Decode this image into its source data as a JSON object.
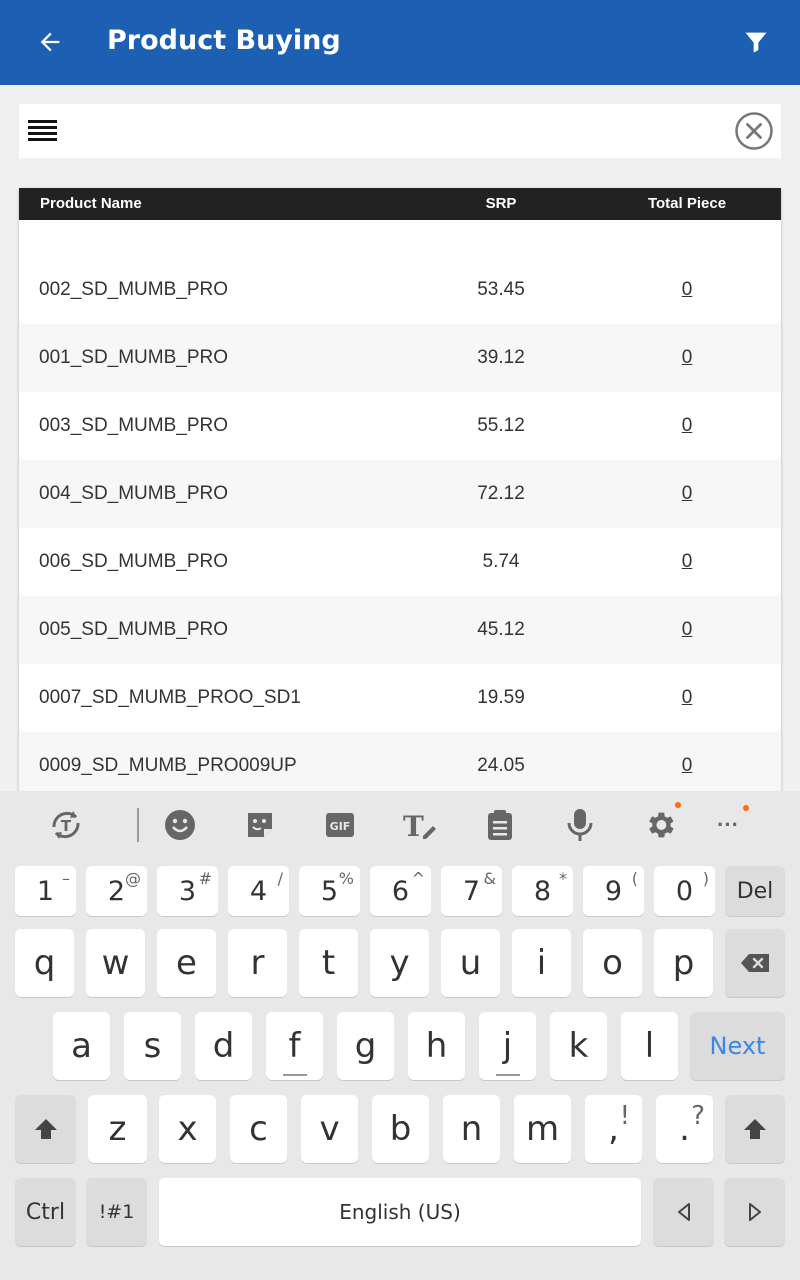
{
  "appbar": {
    "title": "Product Buying",
    "back_icon": "arrow-back-icon",
    "filter_icon": "filter-icon",
    "color": "#1c5fb3"
  },
  "search": {
    "menu_icon": "menu-lines-icon",
    "clear_icon": "close-circle-icon"
  },
  "table": {
    "headers": {
      "name": "Product Name",
      "srp": "SRP",
      "piece": "Total Piece"
    },
    "rows": [
      {
        "name": "002_SD_MUMB_PRO",
        "srp": "53.45",
        "piece": "0"
      },
      {
        "name": "001_SD_MUMB_PRO",
        "srp": "39.12",
        "piece": "0"
      },
      {
        "name": "003_SD_MUMB_PRO",
        "srp": "55.12",
        "piece": "0"
      },
      {
        "name": "004_SD_MUMB_PRO",
        "srp": "72.12",
        "piece": "0"
      },
      {
        "name": "006_SD_MUMB_PRO",
        "srp": "5.74",
        "piece": "0"
      },
      {
        "name": "005_SD_MUMB_PRO",
        "srp": "45.12",
        "piece": "0"
      },
      {
        "name": "0007_SD_MUMB_PROO_SD1",
        "srp": "19.59",
        "piece": "0"
      },
      {
        "name": "0009_SD_MUMB_PRO009UP",
        "srp": "24.05",
        "piece": "0"
      }
    ]
  },
  "keyboard": {
    "toolbar_icons": [
      "translate-icon",
      "emoji-icon",
      "sticker-icon",
      "gif-icon",
      "handwriting-icon",
      "clipboard-icon",
      "microphone-icon",
      "settings-icon",
      "more-icon"
    ],
    "gif_label": "GIF",
    "more_label": "···",
    "number_row": [
      {
        "main": "1",
        "sup": "–"
      },
      {
        "main": "2",
        "sup": "@"
      },
      {
        "main": "3",
        "sup": "#"
      },
      {
        "main": "4",
        "sup": "/"
      },
      {
        "main": "5",
        "sup": "%"
      },
      {
        "main": "6",
        "sup": "^"
      },
      {
        "main": "7",
        "sup": "&"
      },
      {
        "main": "8",
        "sup": "*"
      },
      {
        "main": "9",
        "sup": "("
      },
      {
        "main": "0",
        "sup": ")"
      }
    ],
    "del_label": "Del",
    "row1": [
      "q",
      "w",
      "e",
      "r",
      "t",
      "y",
      "u",
      "i",
      "o",
      "p"
    ],
    "row2": [
      "a",
      "s",
      "d",
      "f",
      "g",
      "h",
      "j",
      "k",
      "l"
    ],
    "next_label": "Next",
    "row3": [
      "z",
      "x",
      "c",
      "v",
      "b",
      "n",
      "m"
    ],
    "comma_label": ",",
    "comma_sup": "!",
    "period_label": ".",
    "period_sup": "?",
    "ctrl_label": "Ctrl",
    "sym_label": "!#1",
    "space_label": "English (US)",
    "accent_color": "#3b86e8"
  }
}
